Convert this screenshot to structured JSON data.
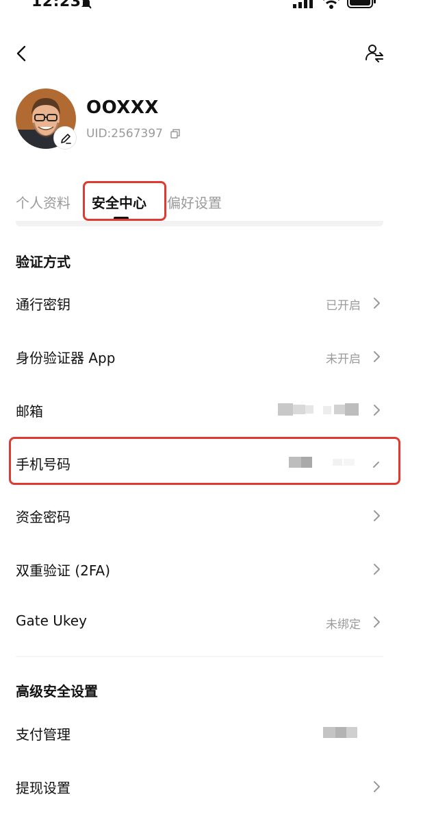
{
  "status_bar": {
    "time": "12:23"
  },
  "profile": {
    "username": "OOXXX",
    "uid": "UID:2567397"
  },
  "tabs": [
    {
      "label": "个人资料",
      "active": false
    },
    {
      "label": "安全中心",
      "active": true
    },
    {
      "label": "偏好设置",
      "active": false
    }
  ],
  "verification": {
    "title": "验证方式",
    "items": [
      {
        "label": "通行密钥",
        "status": "已开启"
      },
      {
        "label": "身份验证器 App",
        "status": "未开启"
      },
      {
        "label": "邮箱",
        "status": ""
      },
      {
        "label": "手机号码",
        "status": ""
      },
      {
        "label": "资金密码",
        "status": ""
      },
      {
        "label": "双重验证 (2FA)",
        "status": ""
      },
      {
        "label": "Gate Ukey",
        "status": "未绑定"
      }
    ]
  },
  "advanced": {
    "title": "高级安全设置",
    "items": [
      {
        "label": "支付管理",
        "status": ""
      },
      {
        "label": "提现设置",
        "status": ""
      }
    ]
  },
  "colors": {
    "highlight": "#e0392f",
    "muted_text": "#9a9a9a",
    "primary_text": "#111111"
  }
}
